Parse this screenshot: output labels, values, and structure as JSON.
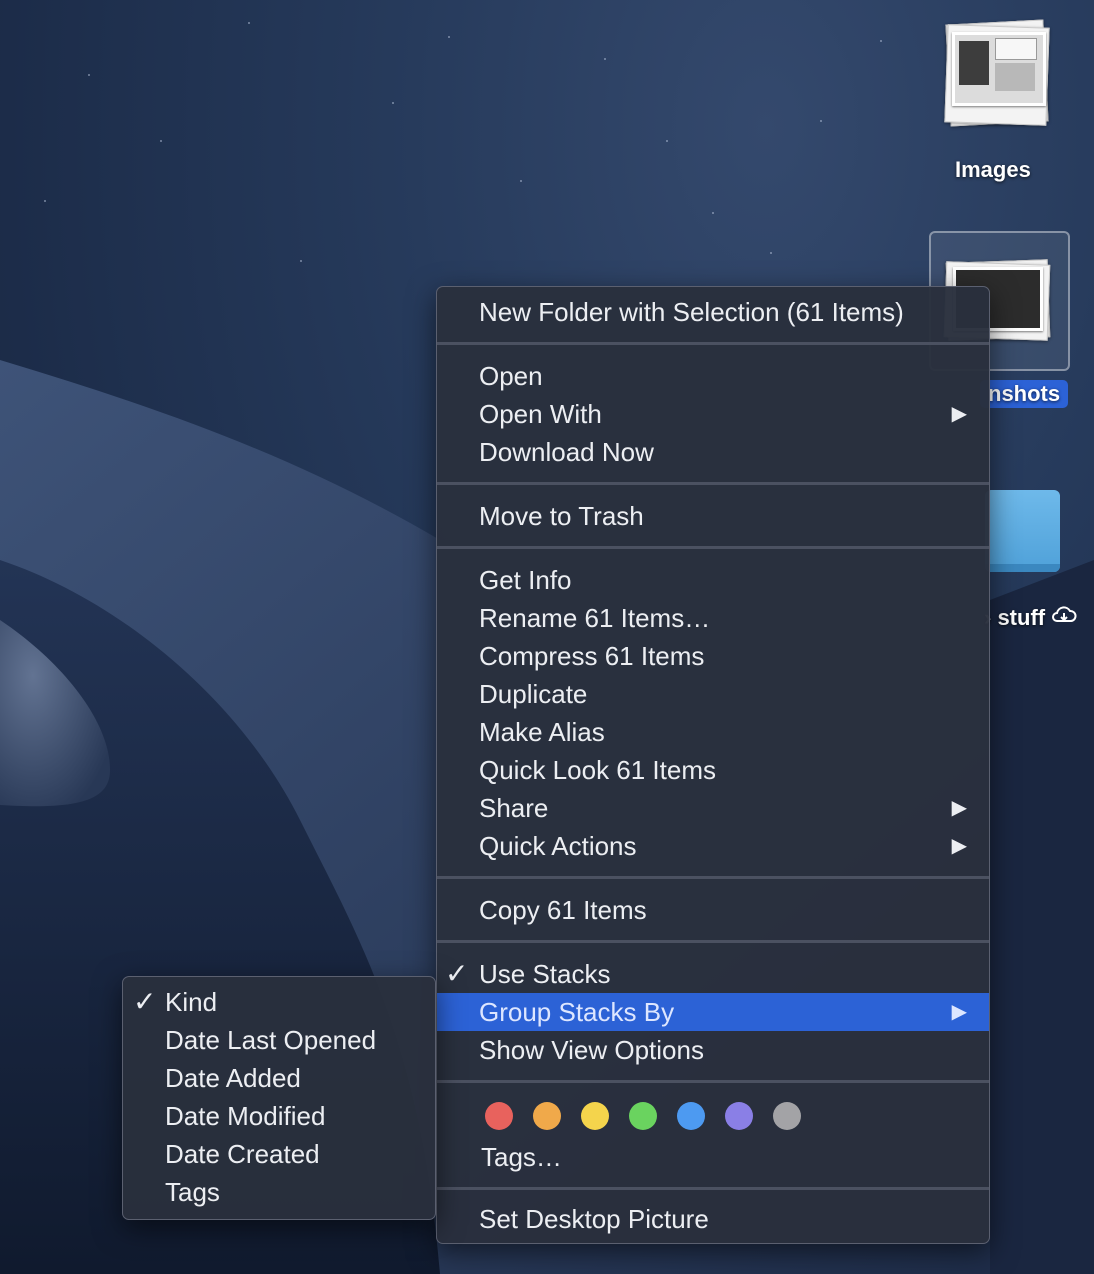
{
  "desktop": {
    "icons": [
      {
        "label": "Images"
      },
      {
        "label": "nshots"
      },
      {
        "label": "› stuff"
      }
    ]
  },
  "context_menu": {
    "groups": [
      [
        {
          "label": "New Folder with Selection (61 Items)"
        }
      ],
      [
        {
          "label": "Open"
        },
        {
          "label": "Open With",
          "submenu": true
        },
        {
          "label": "Download Now"
        }
      ],
      [
        {
          "label": "Move to Trash"
        }
      ],
      [
        {
          "label": "Get Info"
        },
        {
          "label": "Rename 61 Items…"
        },
        {
          "label": "Compress 61 Items"
        },
        {
          "label": "Duplicate"
        },
        {
          "label": "Make Alias"
        },
        {
          "label": "Quick Look 61 Items"
        },
        {
          "label": "Share",
          "submenu": true
        },
        {
          "label": "Quick Actions",
          "submenu": true
        }
      ],
      [
        {
          "label": "Copy 61 Items"
        }
      ],
      [
        {
          "label": "Use Stacks",
          "checked": true
        },
        {
          "label": "Group Stacks By",
          "submenu": true,
          "highlighted": true
        },
        {
          "label": "Show View Options"
        }
      ]
    ],
    "tag_colors": [
      "#e8625d",
      "#f0a94a",
      "#f4d44c",
      "#6ad35f",
      "#4d9af1",
      "#8a7fe6",
      "#a3a3a6"
    ],
    "tags_label": "Tags…",
    "last_item": "Set Desktop Picture",
    "check_glyph": "✓",
    "arrow_glyph": "▶"
  },
  "group_stacks_submenu": {
    "items": [
      {
        "label": "Kind",
        "checked": true
      },
      {
        "label": "Date Last Opened"
      },
      {
        "label": "Date Added"
      },
      {
        "label": "Date Modified"
      },
      {
        "label": "Date Created"
      },
      {
        "label": "Tags"
      }
    ]
  },
  "colors": {
    "highlight": "#2c62d6",
    "menu_bg": "#292f3d"
  }
}
